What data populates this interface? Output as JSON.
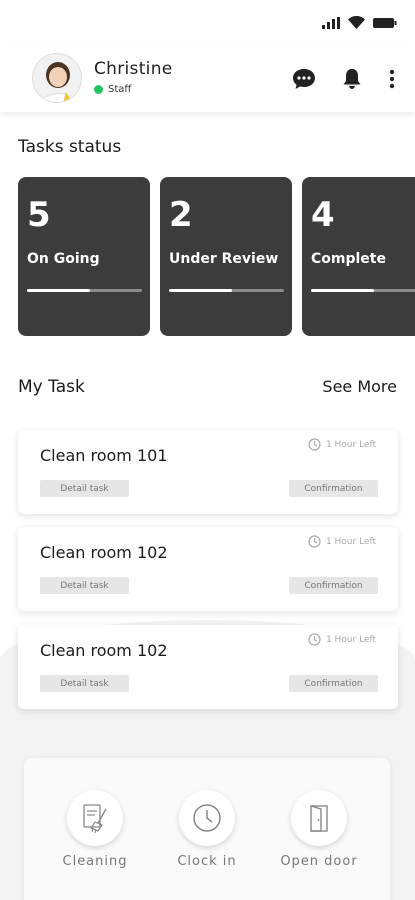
{
  "user": {
    "name": "Christine",
    "role": "Staff"
  },
  "header_icons": [
    "chat-icon",
    "bell-icon",
    "more-vertical-icon"
  ],
  "tasks_status": {
    "title": "Tasks status",
    "cards": [
      {
        "count": "5",
        "label": "On Going",
        "progress": 0.55
      },
      {
        "count": "2",
        "label": "Under Review",
        "progress": 0.55
      },
      {
        "count": "4",
        "label": "Complete",
        "progress": 0.55
      }
    ]
  },
  "my_task": {
    "title": "My Task",
    "see_more": "See More",
    "items": [
      {
        "title": "Clean room 101",
        "time_left": "1 Hour Left",
        "detail": "Detail task",
        "confirm": "Confirmation"
      },
      {
        "title": "Clean room 102",
        "time_left": "1 Hour Left",
        "detail": "Detail task",
        "confirm": "Confirmation"
      },
      {
        "title": "Clean room 102",
        "time_left": "1 Hour Left",
        "detail": "Detail task",
        "confirm": "Confirmation"
      }
    ]
  },
  "quick_actions": [
    {
      "label": "Cleaning",
      "icon": "cleaning-icon"
    },
    {
      "label": "Clock in",
      "icon": "clock-icon"
    },
    {
      "label": "Open door",
      "icon": "door-icon"
    }
  ],
  "colors": {
    "card_bg": "#3c3c3c",
    "online": "#22c55e"
  }
}
